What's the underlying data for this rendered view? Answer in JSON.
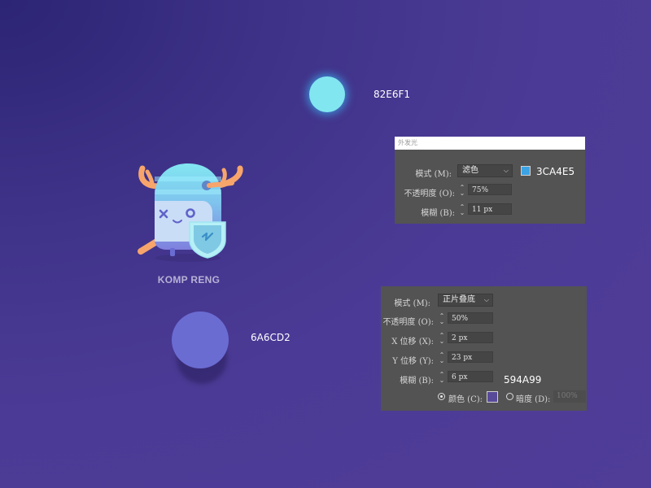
{
  "glow_sample": {
    "hex_label": "82E6F1",
    "fill": "#82E6F1"
  },
  "shadow_sample": {
    "hex_label": "6A6CD2",
    "fill": "#6A6CD2"
  },
  "mascot": {
    "brand_name": "KOMP RENG"
  },
  "outer_glow_panel": {
    "title": "外发光",
    "mode_label": "模式 (M):",
    "mode_value": "滤色",
    "color_hex": "3CA4E5",
    "color": "#3CA4E5",
    "opacity_label": "不透明度 (O):",
    "opacity_value": "75%",
    "blur_label": "模糊 (B):",
    "blur_value": "11 px"
  },
  "drop_shadow_panel": {
    "mode_label": "模式 (M):",
    "mode_value": "正片叠底",
    "opacity_label": "不透明度 (O):",
    "opacity_value": "50%",
    "x_offset_label": "X 位移 (X):",
    "x_offset_value": "2 px",
    "y_offset_label": "Y 位移 (Y):",
    "y_offset_value": "23 px",
    "blur_label": "模糊 (B):",
    "blur_value": "6 px",
    "color_hex": "594A99",
    "color": "#594A99",
    "color_option_label": "颜色 (C):",
    "darkness_option_label": "暗度 (D):",
    "darkness_value": "100%"
  }
}
